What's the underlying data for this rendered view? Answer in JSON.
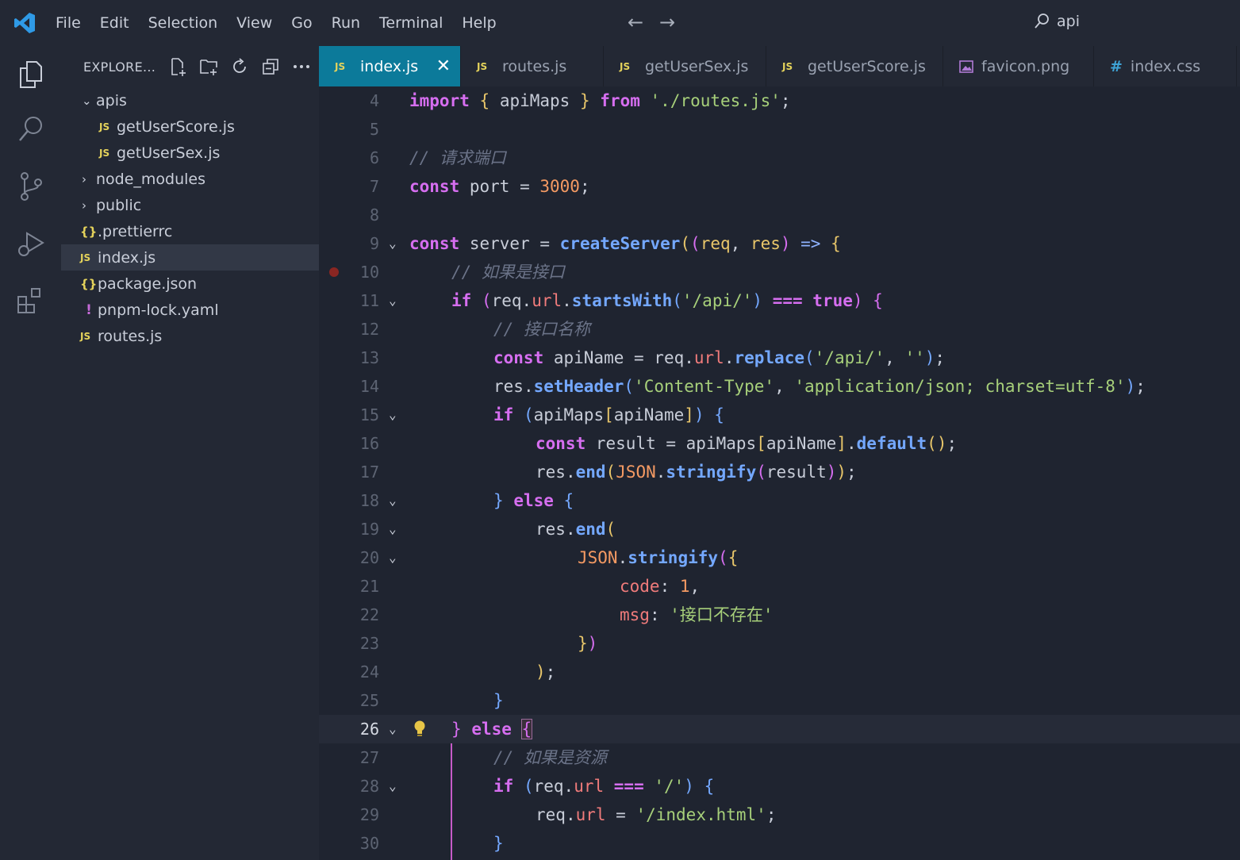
{
  "menu": [
    "File",
    "Edit",
    "Selection",
    "View",
    "Go",
    "Run",
    "Terminal",
    "Help"
  ],
  "command_center": "api",
  "explorer": {
    "title": "EXPLORE...",
    "tree": [
      {
        "label": "apis",
        "kind": "folder-open",
        "indent": 1
      },
      {
        "label": "getUserScore.js",
        "kind": "js",
        "indent": 2
      },
      {
        "label": "getUserSex.js",
        "kind": "js",
        "indent": 2
      },
      {
        "label": "node_modules",
        "kind": "folder",
        "indent": 1
      },
      {
        "label": "public",
        "kind": "folder",
        "indent": 1
      },
      {
        "label": ".prettierrc",
        "kind": "json",
        "indent": 1
      },
      {
        "label": "index.js",
        "kind": "js",
        "indent": 1,
        "selected": true
      },
      {
        "label": "package.json",
        "kind": "json",
        "indent": 1
      },
      {
        "label": "pnpm-lock.yaml",
        "kind": "yaml",
        "indent": 1
      },
      {
        "label": "routes.js",
        "kind": "js",
        "indent": 1
      }
    ]
  },
  "tabs": [
    {
      "label": "index.js",
      "icon": "JS",
      "active": true
    },
    {
      "label": "routes.js",
      "icon": "JS"
    },
    {
      "label": "getUserSex.js",
      "icon": "JS"
    },
    {
      "label": "getUserScore.js",
      "icon": "JS"
    },
    {
      "label": "favicon.png",
      "icon": "image-icon"
    },
    {
      "label": "index.css",
      "icon": "#"
    }
  ],
  "editor": {
    "current_line": 26,
    "breakpoint_line": 10,
    "line_numbers": [
      "4",
      "5",
      "6",
      "7",
      "8",
      "9",
      "10",
      "11",
      "12",
      "13",
      "14",
      "15",
      "16",
      "17",
      "18",
      "19",
      "20",
      "21",
      "22",
      "23",
      "24",
      "25",
      "26",
      "27",
      "28",
      "29",
      "30"
    ],
    "code": {
      "l4": [
        "import",
        " ",
        "{",
        " apiMaps ",
        "}",
        " ",
        "from",
        " ",
        "'./routes.js'",
        ";"
      ],
      "l6": "// 请求端口",
      "l7": [
        "const",
        " port = ",
        "3000",
        ";"
      ],
      "l9": [
        "const",
        " server = ",
        "createServer",
        "(",
        "(",
        "req",
        ", ",
        "res",
        ")",
        " => ",
        "{"
      ],
      "l10": "// 如果是接口",
      "l11": [
        "if",
        " ",
        "(",
        "req",
        ".",
        "url",
        ".",
        "startsWith",
        "(",
        "'/api/'",
        ")",
        " === ",
        "true",
        ")",
        " ",
        "{"
      ],
      "l12": "// 接口名称",
      "l13": [
        "const",
        " apiName = ",
        "req",
        ".",
        "url",
        ".",
        "replace",
        "(",
        "'/api/'",
        ", ",
        "''",
        ")",
        ";"
      ],
      "l14": [
        "res",
        ".",
        "setHeader",
        "(",
        "'Content-Type'",
        ", ",
        "'application/json; charset=utf-8'",
        ")",
        ";"
      ],
      "l15": [
        "if",
        " ",
        "(",
        "apiMaps",
        "[",
        "apiName",
        "]",
        ")",
        " ",
        "{"
      ],
      "l16": [
        "const",
        " result = ",
        "apiMaps",
        "[",
        "apiName",
        "]",
        ".",
        "default",
        "(",
        ")",
        ";"
      ],
      "l17": [
        "res",
        ".",
        "end",
        "(",
        "JSON",
        ".",
        "stringify",
        "(",
        "result",
        ")",
        ")",
        ";"
      ],
      "l18": [
        "}",
        " ",
        "else",
        " ",
        "{"
      ],
      "l19": [
        "res",
        ".",
        "end",
        "("
      ],
      "l20": [
        "JSON",
        ".",
        "stringify",
        "(",
        "{"
      ],
      "l21": [
        "code",
        ": ",
        "1",
        ","
      ],
      "l22": [
        "msg",
        ": ",
        "'接口不存在'"
      ],
      "l23": [
        "}",
        ")"
      ],
      "l24": [
        ")",
        ";"
      ],
      "l25": [
        "}"
      ],
      "l26": [
        "}",
        " ",
        "else",
        " ",
        "{"
      ],
      "l27": "// 如果是资源",
      "l28": [
        "if",
        " ",
        "(",
        "req",
        ".",
        "url",
        " === ",
        "'/'",
        ")",
        " ",
        "{"
      ],
      "l29": [
        "req",
        ".",
        "url",
        " = ",
        "'/index.html'",
        ";"
      ],
      "l30": [
        "}"
      ]
    }
  }
}
